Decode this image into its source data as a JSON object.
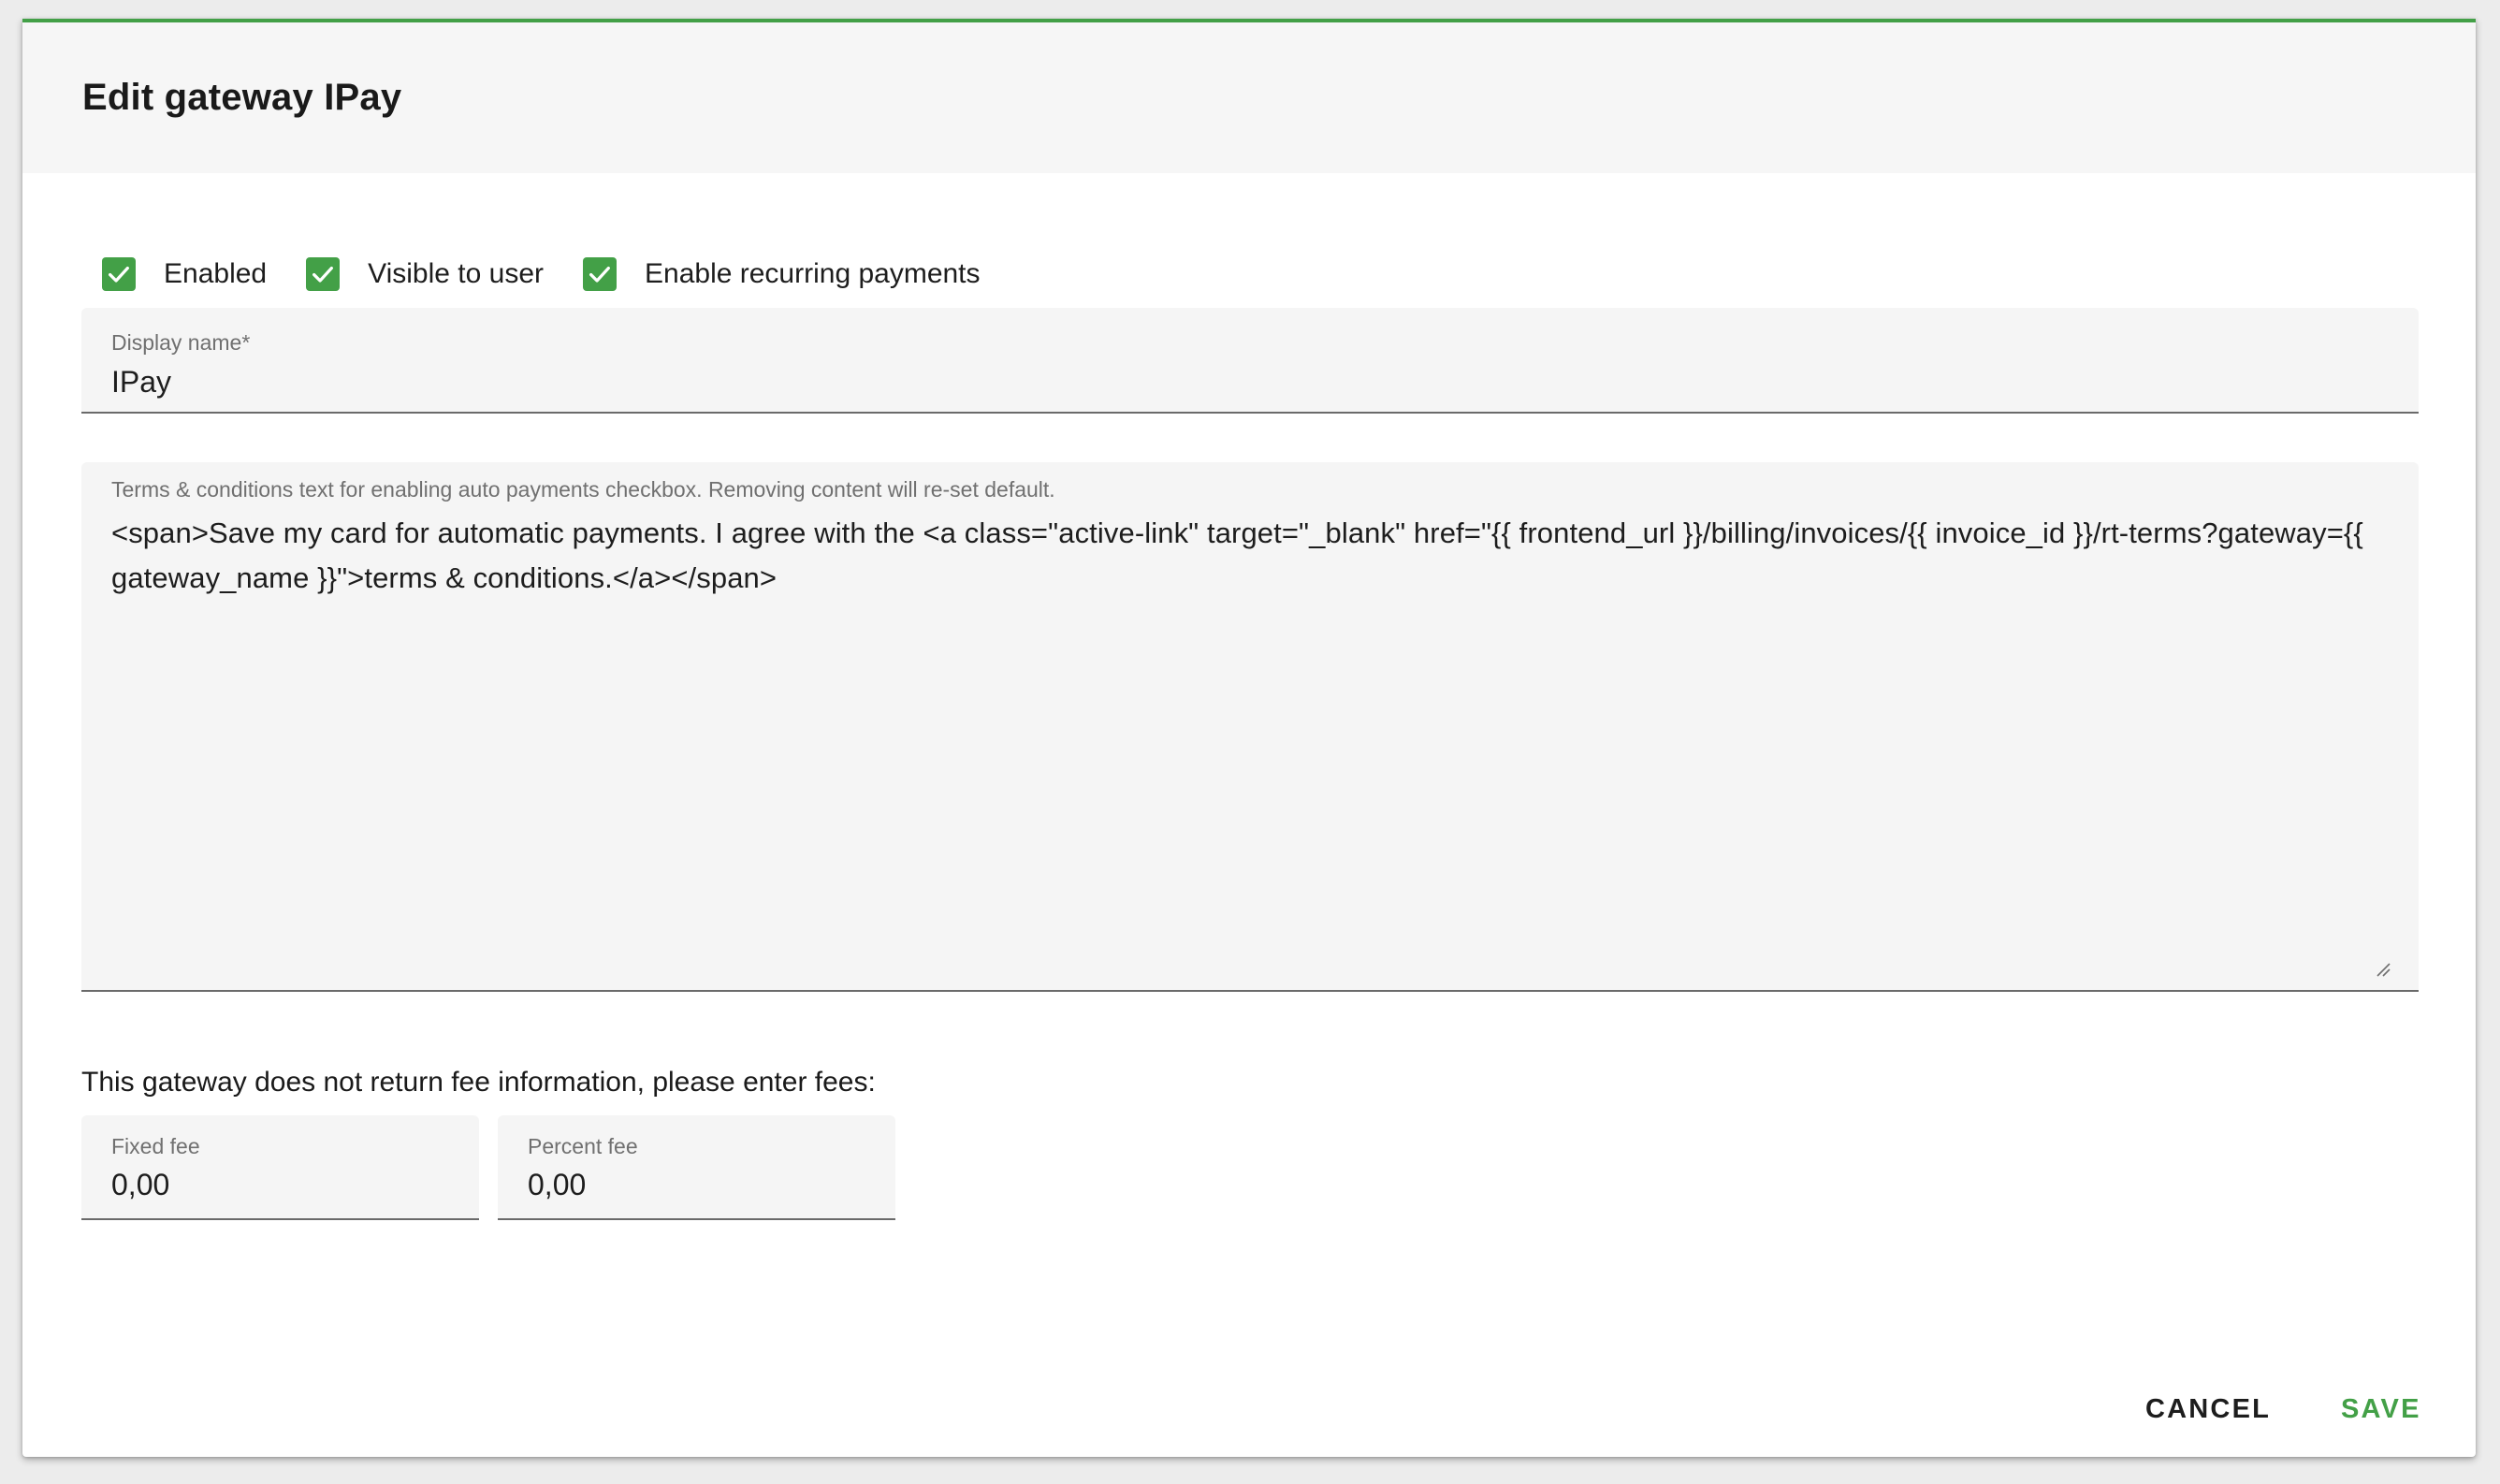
{
  "dialog": {
    "title": "Edit gateway IPay",
    "accent_color": "#43a047"
  },
  "checkboxes": [
    {
      "label": "Enabled",
      "checked": true
    },
    {
      "label": "Visible to user",
      "checked": true
    },
    {
      "label": "Enable recurring payments",
      "checked": true
    }
  ],
  "display_name": {
    "label": "Display name*",
    "value": "IPay"
  },
  "terms": {
    "label": "Terms & conditions text for enabling auto payments checkbox. Removing content will re-set default.",
    "value": "<span>Save my card for automatic payments. I agree with the <a class=\"active-link\" target=\"_blank\" href=\"{{ frontend_url }}/billing/invoices/{{ invoice_id }}/rt-terms?gateway={{ gateway_name }}\">terms & conditions.</a></span>"
  },
  "fees": {
    "heading": "This gateway does not return fee information, please enter fees:",
    "fixed": {
      "label": "Fixed fee",
      "value": "0,00"
    },
    "percent": {
      "label": "Percent fee",
      "value": "0,00"
    }
  },
  "actions": {
    "cancel_label": "CANCEL",
    "save_label": "SAVE"
  }
}
